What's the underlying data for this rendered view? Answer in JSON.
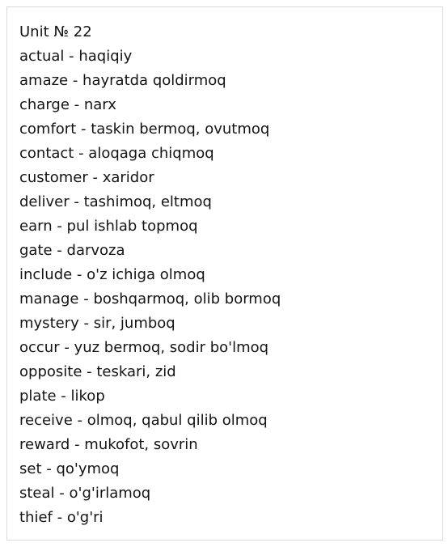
{
  "title": "Unit № 22",
  "entries": [
    "actual - haqiqiy",
    "amaze - hayratda qoldirmoq",
    "charge - narx",
    "comfort - taskin bermoq, ovutmoq",
    "contact - aloqaga chiqmoq",
    "customer - xaridor",
    "deliver - tashimoq, eltmoq",
    "earn - pul ishlab topmoq",
    "gate - darvoza",
    "include - o'z ichiga olmoq",
    "manage - boshqarmoq, olib bormoq",
    "mystery - sir, jumboq",
    "occur - yuz bermoq, sodir bo'lmoq",
    "opposite - teskari, zid",
    "plate - likop",
    "receive - olmoq, qabul qilib olmoq",
    "reward - mukofot, sovrin",
    "set - qo'ymoq",
    "steal - o'g'irlamoq",
    "thief - o'g'ri"
  ]
}
